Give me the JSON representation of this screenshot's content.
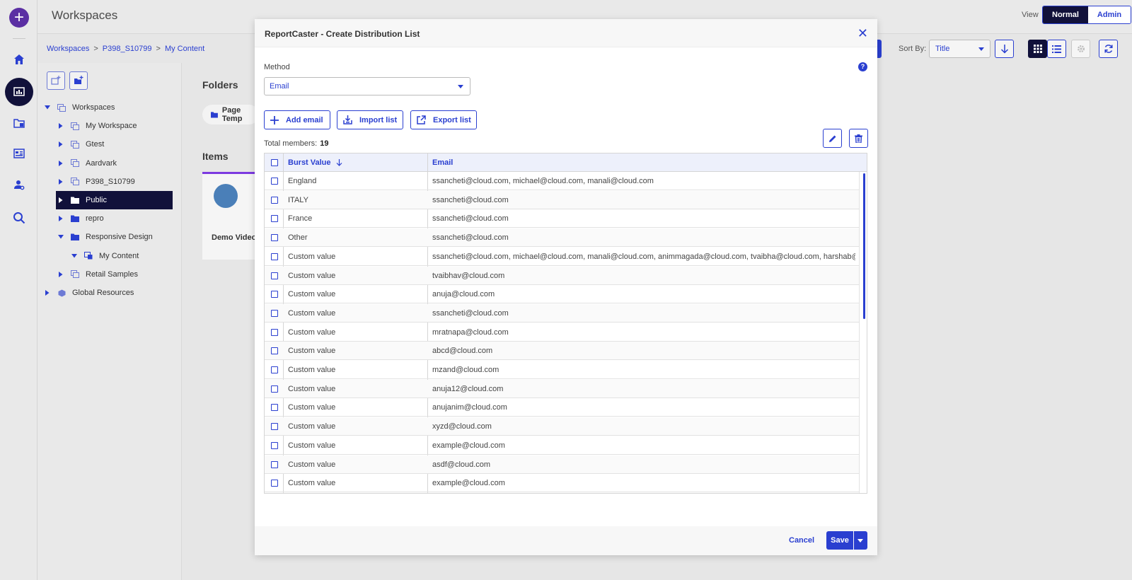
{
  "header": {
    "title": "Workspaces",
    "view_label": "View",
    "view_normal": "Normal",
    "view_admin": "Admin"
  },
  "breadcrumb": [
    "Workspaces",
    "P398_S10799",
    "My Content"
  ],
  "breadcrumb_sep": ">",
  "tree": [
    {
      "label": "Workspaces",
      "level": 0,
      "expanded": true,
      "icon": "workspace-icon"
    },
    {
      "label": "My Workspace",
      "level": 1,
      "expanded": false,
      "icon": "workspace-icon"
    },
    {
      "label": "Gtest",
      "level": 1,
      "expanded": false,
      "icon": "workspace-icon"
    },
    {
      "label": "Aardvark",
      "level": 1,
      "expanded": false,
      "icon": "workspace-icon"
    },
    {
      "label": "P398_S10799",
      "level": 1,
      "expanded": false,
      "icon": "workspace-icon"
    },
    {
      "label": "Public",
      "level": 1,
      "expanded": false,
      "icon": "folder-icon",
      "selected": true
    },
    {
      "label": "repro",
      "level": 1,
      "expanded": false,
      "icon": "folder-icon"
    },
    {
      "label": "Responsive Design",
      "level": 1,
      "expanded": true,
      "icon": "folder-icon"
    },
    {
      "label": "My Content",
      "level": 2,
      "expanded": true,
      "icon": "my-content-icon"
    },
    {
      "label": "Retail Samples",
      "level": 1,
      "expanded": false,
      "icon": "workspace-icon"
    },
    {
      "label": "Global Resources",
      "level": 0,
      "expanded": false,
      "icon": "global-resources-icon"
    }
  ],
  "content": {
    "folders_heading": "Folders",
    "folder_chip": "Page Temp",
    "items_heading": "Items",
    "item_title": "Demo Video"
  },
  "sort": {
    "label": "Sort By:",
    "value": "Title"
  },
  "modal": {
    "title": "ReportCaster - Create Distribution List",
    "method_label": "Method",
    "method_value": "Email",
    "add_email": "Add email",
    "import_list": "Import list",
    "export_list": "Export list",
    "total_label": "Total members:",
    "total_count": "19",
    "col_burst": "Burst Value",
    "col_email": "Email",
    "cancel": "Cancel",
    "save": "Save",
    "rows": [
      {
        "burst": "England",
        "email": "ssancheti@cloud.com, michael@cloud.com, manali@cloud.com"
      },
      {
        "burst": "ITALY",
        "email": "ssancheti@cloud.com"
      },
      {
        "burst": "France",
        "email": "ssancheti@cloud.com"
      },
      {
        "burst": "Other",
        "email": "ssancheti@cloud.com"
      },
      {
        "burst": "Custom value",
        "email": "ssancheti@cloud.com, michael@cloud.com, manali@cloud.com, animmagada@cloud.com, tvaibha@cloud.com, harshab@cloud.com.."
      },
      {
        "burst": "Custom value",
        "email": "tvaibhav@cloud.com"
      },
      {
        "burst": "Custom value",
        "email": "anuja@cloud.com"
      },
      {
        "burst": "Custom value",
        "email": "ssancheti@cloud.com"
      },
      {
        "burst": "Custom value",
        "email": "mratnapa@cloud.com"
      },
      {
        "burst": "Custom value",
        "email": "abcd@cloud.com"
      },
      {
        "burst": "Custom value",
        "email": "mzand@cloud.com"
      },
      {
        "burst": "Custom value",
        "email": "anuja12@cloud.com"
      },
      {
        "burst": "Custom value",
        "email": "anujanim@cloud.com"
      },
      {
        "burst": "Custom value",
        "email": "xyzd@cloud.com"
      },
      {
        "burst": "Custom value",
        "email": "example@cloud.com"
      },
      {
        "burst": "Custom value",
        "email": "asdf@cloud.com"
      },
      {
        "burst": "Custom value",
        "email": "example@cloud.com"
      }
    ]
  },
  "colors": {
    "accent": "#2a3fd0",
    "selected_bg": "#11113a",
    "brand_purple": "#5b2fa3"
  }
}
